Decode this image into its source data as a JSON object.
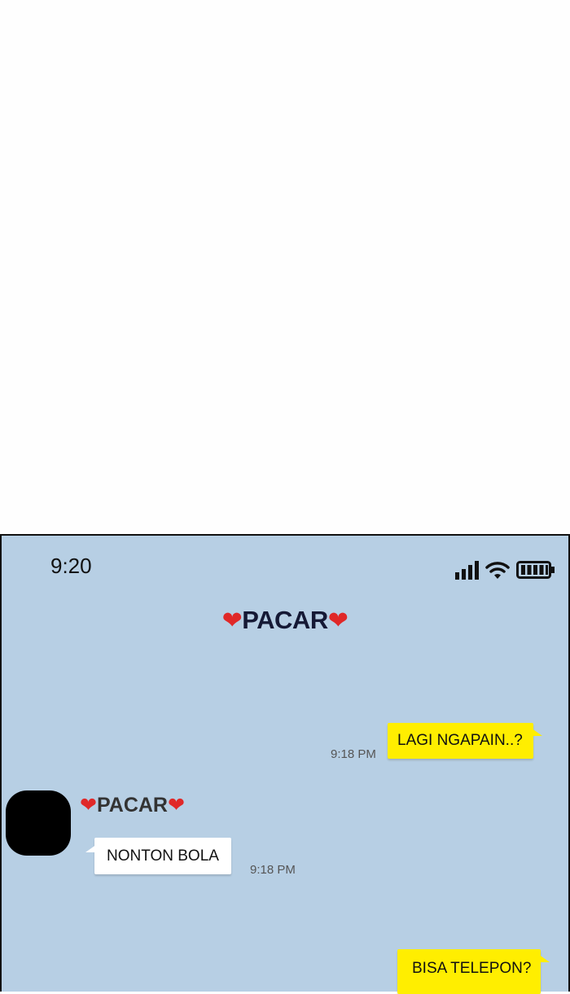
{
  "status_bar": {
    "time": "9:20"
  },
  "chat": {
    "title_name": "PACAR",
    "title_heart": "❤",
    "messages": [
      {
        "direction": "out",
        "text": "LAGI NGAPAIN..?",
        "time": "9:18 PM"
      },
      {
        "direction": "in",
        "sender": "PACAR",
        "text": "NONTON BOLA",
        "time": "9:18 PM"
      },
      {
        "direction": "out",
        "text": "BISA TELEPON?"
      }
    ]
  },
  "icons": [
    "signal-icon",
    "wifi-icon",
    "battery-icon",
    "user-avatar-icon"
  ],
  "colors": {
    "chat_background": "#b7cfe4",
    "outgoing_bubble": "#ffee00",
    "incoming_bubble": "#ffffff",
    "avatar": "#000000"
  }
}
